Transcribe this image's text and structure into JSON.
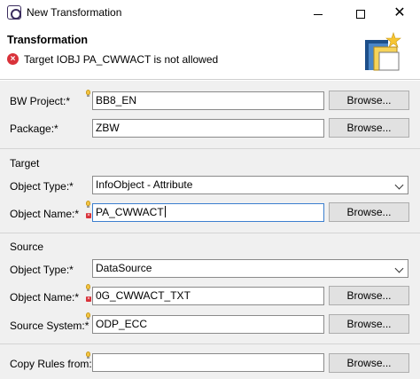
{
  "window": {
    "title": "New Transformation",
    "minimize": "",
    "maximize": "",
    "close": "✕"
  },
  "header": {
    "title": "Transformation",
    "error_icon": "error-icon",
    "error_message": "Target IOBJ PA_CWWACT is not allowed"
  },
  "fields": {
    "bw_project": {
      "label": "BW Project:*",
      "value": "BB8_EN",
      "button": "Browse..."
    },
    "package": {
      "label": "Package:*",
      "value": "ZBW",
      "button": "Browse..."
    }
  },
  "target": {
    "section_label": "Target",
    "object_type": {
      "label": "Object Type:*",
      "value": "InfoObject - Attribute"
    },
    "object_name": {
      "label": "Object Name:*",
      "value": "PA_CWWACT",
      "button": "Browse..."
    }
  },
  "source": {
    "section_label": "Source",
    "object_type": {
      "label": "Object Type:*",
      "value": "DataSource"
    },
    "object_name": {
      "label": "Object Name:*",
      "value": "0G_CWWACT_TXT",
      "button": "Browse..."
    },
    "source_system": {
      "label": "Source System:*",
      "value": "ODP_ECC",
      "button": "Browse..."
    }
  },
  "copy_rules": {
    "label": "Copy Rules from:",
    "value": "",
    "button": "Browse..."
  },
  "colors": {
    "error": "#d9323a",
    "focus_border": "#3c7fcf",
    "panel_bg": "#f0f0f0"
  }
}
